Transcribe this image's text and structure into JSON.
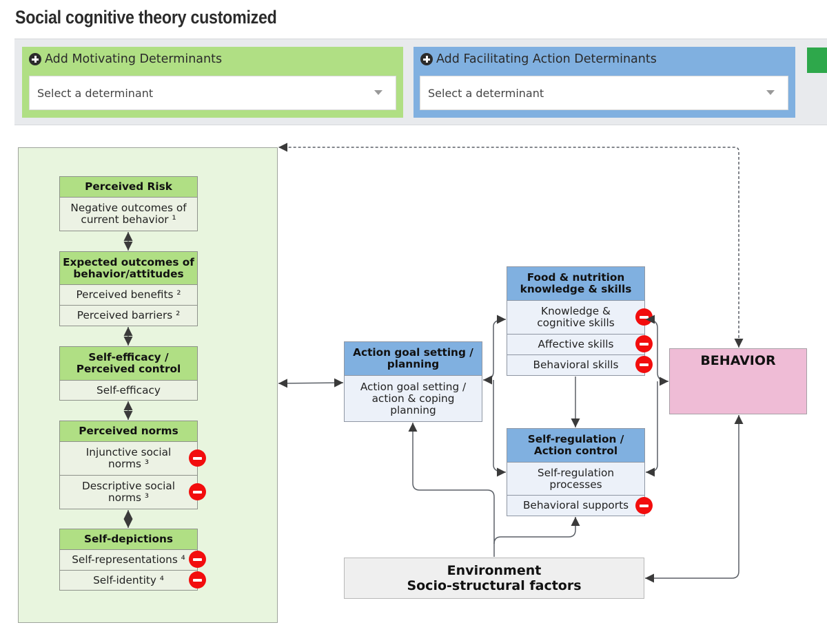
{
  "page": {
    "title": "Social cognitive theory customized"
  },
  "toolbar": {
    "motivating": {
      "label": "Add Motivating Determinants",
      "placeholder": "Select a determinant",
      "color": "#b0df84"
    },
    "facilitating": {
      "label": "Add Facilitating Action Determinants",
      "placeholder": "Select a determinant",
      "color": "#80b0e0"
    },
    "extra_button_color": "#2ea84b"
  },
  "diagram": {
    "motivating_group_color": "#e8f5de",
    "perceived_risk": {
      "title": "Perceived Risk",
      "items": [
        {
          "label": "Negative outcomes of current behavior ¹",
          "removable": false
        }
      ]
    },
    "expected_outcomes": {
      "title": "Expected outcomes of behavior/attitudes",
      "items": [
        {
          "label": "Perceived benefits ²",
          "removable": false
        },
        {
          "label": "Perceived barriers ²",
          "removable": false
        }
      ]
    },
    "self_efficacy": {
      "title": "Self-efficacy / Perceived control",
      "items": [
        {
          "label": "Self-efficacy",
          "removable": false
        }
      ]
    },
    "perceived_norms": {
      "title": "Perceived norms",
      "items": [
        {
          "label": "Injunctive social norms ³",
          "removable": true
        },
        {
          "label": "Descriptive social norms ³",
          "removable": true
        }
      ]
    },
    "self_depictions": {
      "title": "Self-depictions",
      "items": [
        {
          "label": "Self-representations ⁴",
          "removable": true
        },
        {
          "label": "Self-identity ⁴",
          "removable": true
        }
      ]
    },
    "action_goal": {
      "title": "Action goal setting / planning",
      "items": [
        {
          "label": "Action goal setting / action & coping planning",
          "removable": false
        }
      ]
    },
    "food_nutrition": {
      "title": "Food & nutrition knowledge & skills",
      "items": [
        {
          "label": "Knowledge & cognitive skills",
          "removable": true
        },
        {
          "label": "Affective skills",
          "removable": true
        },
        {
          "label": "Behavioral skills",
          "removable": true
        }
      ]
    },
    "self_regulation": {
      "title": "Self-regulation / Action control",
      "items": [
        {
          "label": "Self-regulation processes",
          "removable": false
        },
        {
          "label": "Behavioral supports",
          "removable": true
        }
      ]
    },
    "behavior": {
      "title": "BEHAVIOR",
      "color": "#efbcd6"
    },
    "environment": {
      "line1": "Environment",
      "line2": "Socio-structural factors"
    },
    "remove_icon_color": "#f20d0d"
  }
}
